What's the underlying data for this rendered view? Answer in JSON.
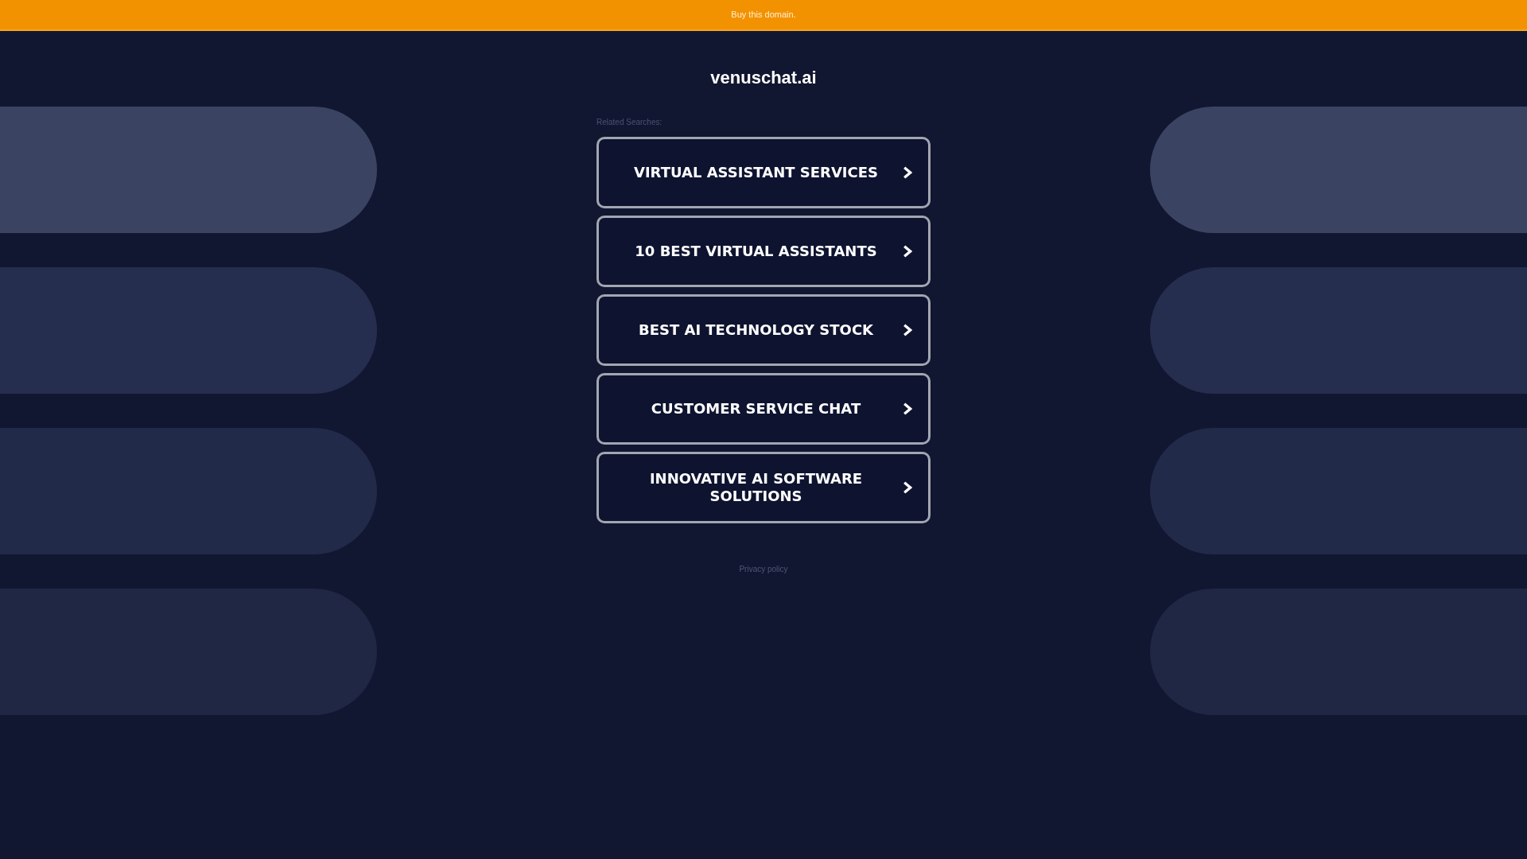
{
  "top_banner": {
    "link": "Buy this domain."
  },
  "header": {
    "title": "venuschat.ai"
  },
  "related_searches": {
    "heading": "Related Searches:",
    "items": [
      {
        "label": "VIRTUAL ASSISTANT SERVICES"
      },
      {
        "label": "10 BEST VIRTUAL ASSISTANTS"
      },
      {
        "label": "BEST AI TECHNOLOGY STOCK"
      },
      {
        "label": "CUSTOMER SERVICE CHAT"
      },
      {
        "label": "INNOVATIVE AI SOFTWARE SOLUTIONS"
      }
    ]
  },
  "footer": {
    "privacy_link": "Privacy policy"
  }
}
